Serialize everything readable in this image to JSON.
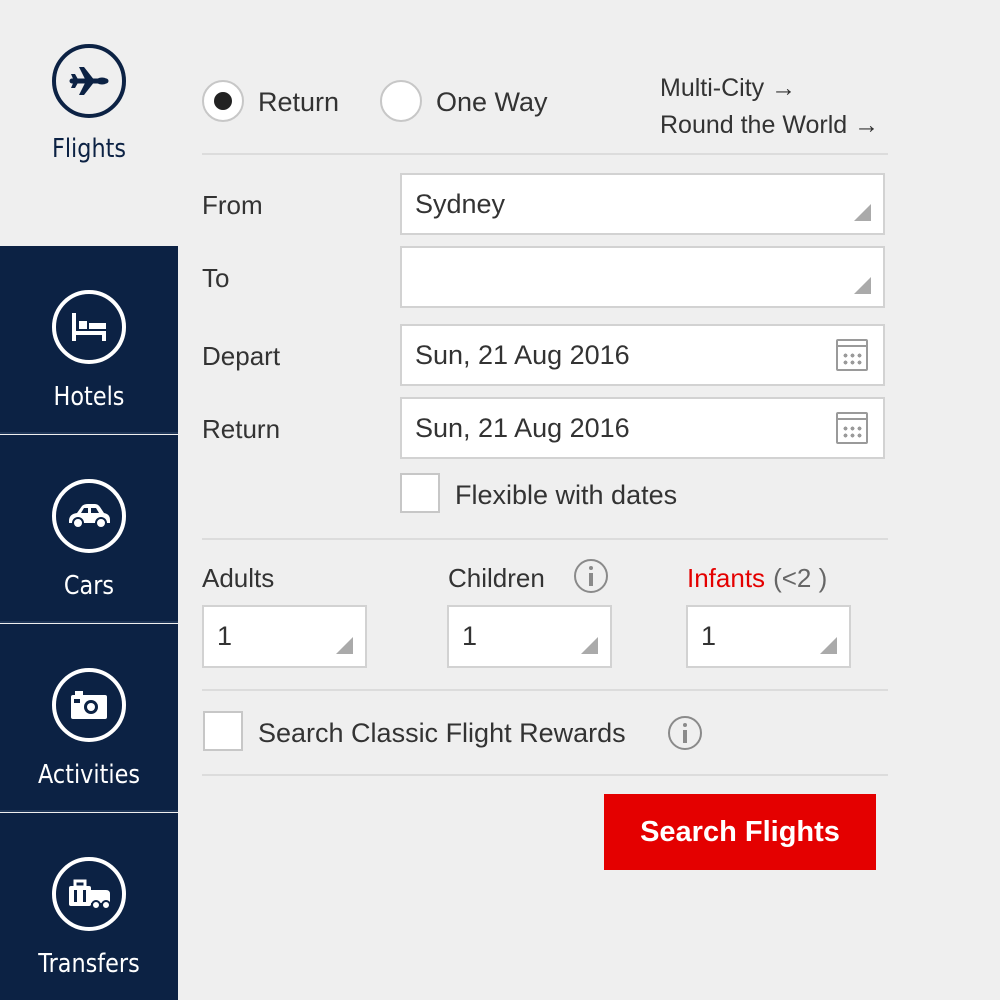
{
  "sidebar": {
    "items": [
      {
        "label": "Flights",
        "icon": "plane-icon",
        "active": true
      },
      {
        "label": "Hotels",
        "icon": "bed-icon"
      },
      {
        "label": "Cars",
        "icon": "car-icon"
      },
      {
        "label": "Activities",
        "icon": "camera-icon"
      },
      {
        "label": "Transfers",
        "icon": "luggage-icon"
      }
    ]
  },
  "trip_type": {
    "return_label": "Return",
    "oneway_label": "One Way",
    "selected": "Return",
    "multicity_link": "Multi-City →",
    "rtw_link": "Round the World →"
  },
  "form": {
    "from": {
      "label": "From",
      "value": "Sydney"
    },
    "to": {
      "label": "To",
      "value": ""
    },
    "depart": {
      "label": "Depart",
      "value": "Sun, 21 Aug 2016"
    },
    "return": {
      "label": "Return",
      "value": "Sun, 21 Aug 2016"
    },
    "flexible_label": "Flexible with dates"
  },
  "passengers": {
    "adults": {
      "label": "Adults",
      "value": "1"
    },
    "children": {
      "label": "Children",
      "value": "1"
    },
    "infants": {
      "label": "Infants",
      "note": "(<2 )",
      "value": "1"
    }
  },
  "rewards": {
    "label": "Search Classic Flight Rewards"
  },
  "search_button": {
    "label": "Search Flights"
  },
  "colors": {
    "navy": "#0c2244",
    "accent_red": "#e40000",
    "background": "#efefef"
  }
}
